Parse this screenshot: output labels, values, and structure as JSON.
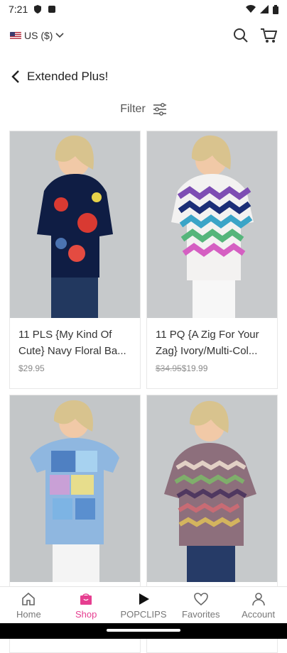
{
  "status_bar": {
    "time": "7:21"
  },
  "header": {
    "currency": "US ($)",
    "title": "Extended Plus!"
  },
  "filter": {
    "label": "Filter"
  },
  "products": [
    {
      "name": "11 PLS {My Kind Of Cute} Navy Floral Ba...",
      "price": "$29.95"
    },
    {
      "name": "11 PQ {A Zig For Your Zag} Ivory/Multi-Col...",
      "old_price": "$34.95",
      "price": "$19.99"
    },
    {
      "name": "",
      "price": ""
    },
    {
      "name": "",
      "price": ""
    }
  ],
  "bottom_nav": [
    {
      "label": "Home"
    },
    {
      "label": "Shop"
    },
    {
      "label": "POPCLIPS"
    },
    {
      "label": "Favorites"
    },
    {
      "label": "Account"
    }
  ],
  "colors": {
    "accent": "#e63e90",
    "text": "#222222",
    "muted": "#888888"
  },
  "icons": {
    "back": "chevron-left-icon",
    "search": "search-icon",
    "cart": "cart-icon",
    "filter": "sliders-icon"
  }
}
